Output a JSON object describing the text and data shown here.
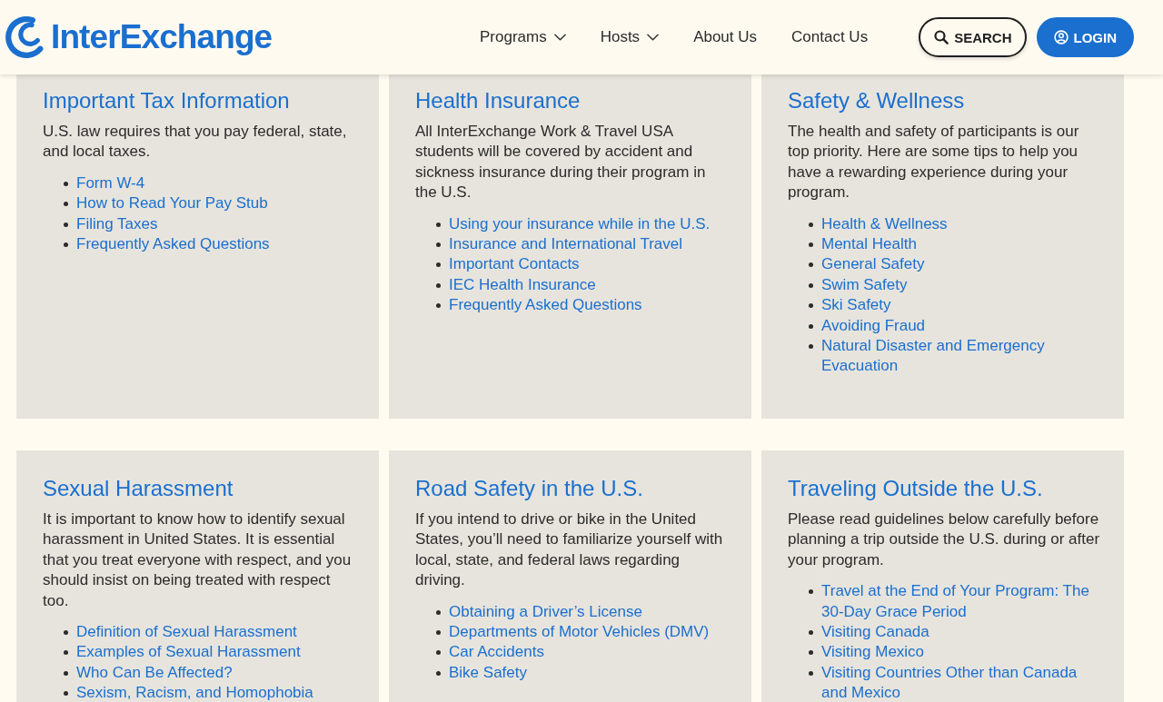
{
  "header": {
    "logo": {
      "text": "InterExchange"
    },
    "nav": [
      {
        "label": "Programs",
        "has_menu": true
      },
      {
        "label": "Hosts",
        "has_menu": true
      },
      {
        "label": "About Us",
        "has_menu": false
      },
      {
        "label": "Contact Us",
        "has_menu": false
      }
    ],
    "search_button": "SEARCH",
    "login_button": "LOGIN"
  },
  "cards": [
    {
      "title": "Important Tax Information",
      "description": "U.S. law requires that you pay federal, state, and local taxes.",
      "links": [
        "Form W-4",
        "How to Read Your Pay Stub",
        "Filing Taxes",
        "Frequently Asked Questions"
      ]
    },
    {
      "title": "Health Insurance",
      "description": "All InterExchange Work & Travel USA students will be covered by accident and sickness insurance during their program in the U.S.",
      "links": [
        "Using your insurance while in the U.S.",
        "Insurance and International Travel",
        "Important Contacts",
        "IEC Health Insurance",
        "Frequently Asked Questions"
      ]
    },
    {
      "title": "Safety & Wellness",
      "description": "The health and safety of participants is our top priority. Here are some tips to help you have a rewarding experience during your program.",
      "links": [
        "Health & Wellness",
        "Mental Health",
        "General Safety",
        "Swim Safety",
        "Ski Safety",
        "Avoiding Fraud",
        "Natural Disaster and Emergency Evacuation"
      ]
    },
    {
      "title": "Sexual Harassment",
      "description": "It is important to know how to identify sexual harassment in United States. It is essential that you treat everyone with respect, and you should insist on being treated with respect too.",
      "links": [
        "Definition of Sexual Harassment",
        "Examples of Sexual Harassment",
        "Who Can Be Affected?",
        "Sexism, Racism, and Homophobia"
      ]
    },
    {
      "title": "Road Safety in the U.S.",
      "description": "If you intend to drive or bike in the United States, you’ll need to familiarize yourself with local, state, and federal laws regarding driving.",
      "links": [
        "Obtaining a Driver’s License",
        "Departments of Motor Vehicles (DMV)",
        "Car Accidents",
        "Bike Safety"
      ]
    },
    {
      "title": "Traveling Outside the U.S.",
      "description": "Please read guidelines below carefully before planning a trip outside the U.S. during or after your program.",
      "links": [
        "Travel at the End of Your Program: The 30-Day Grace Period",
        "Visiting Canada",
        "Visiting Mexico",
        "Visiting Countries Other than Canada and Mexico"
      ]
    }
  ]
}
